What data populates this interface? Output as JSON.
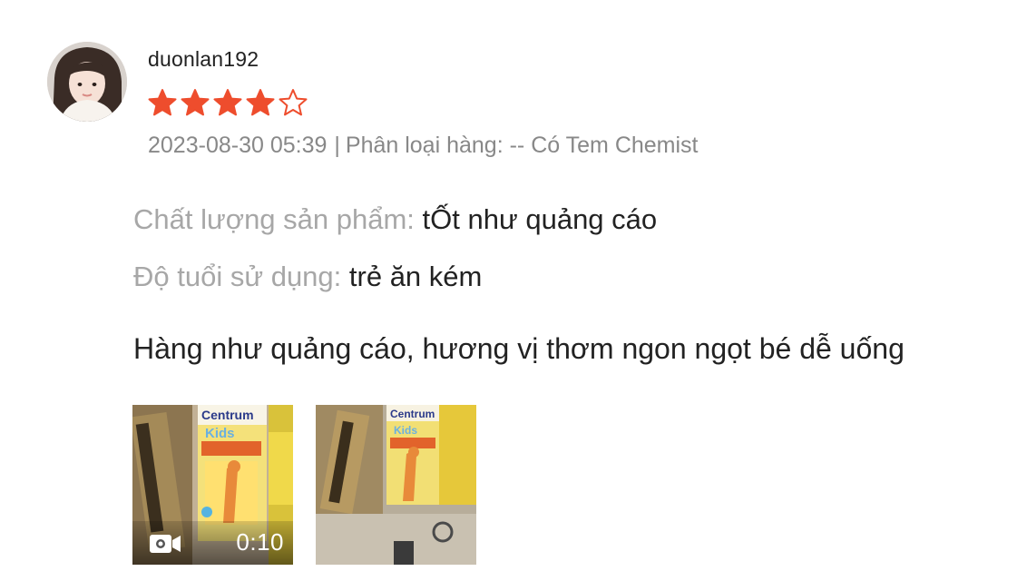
{
  "review": {
    "user": {
      "username": "duonlan192",
      "avatar_icon": "user-avatar"
    },
    "rating": {
      "value": 4,
      "max": 5,
      "star_color": "#ee4d2d"
    },
    "meta": {
      "datetime": "2023-08-30 05:39",
      "separator": "|",
      "variation": "Phân loại hàng: -- Có Tem Chemist"
    },
    "fields": [
      {
        "label": "Chất lượng sản phẩm:",
        "value": "tỐt như quảng cáo"
      },
      {
        "label": "Độ tuổi sử dụng:",
        "value": "trẻ ăn kém"
      }
    ],
    "comment": "Hàng như quảng cáo, hương vị thơm ngon ngọt bé dễ uống",
    "media": [
      {
        "type": "video",
        "duration": "0:10",
        "icon": "video-camera-icon",
        "box_label": "Centrum",
        "box_sub": "Kids"
      },
      {
        "type": "image",
        "box_label": "Centrum",
        "box_sub": "Kids"
      }
    ]
  }
}
